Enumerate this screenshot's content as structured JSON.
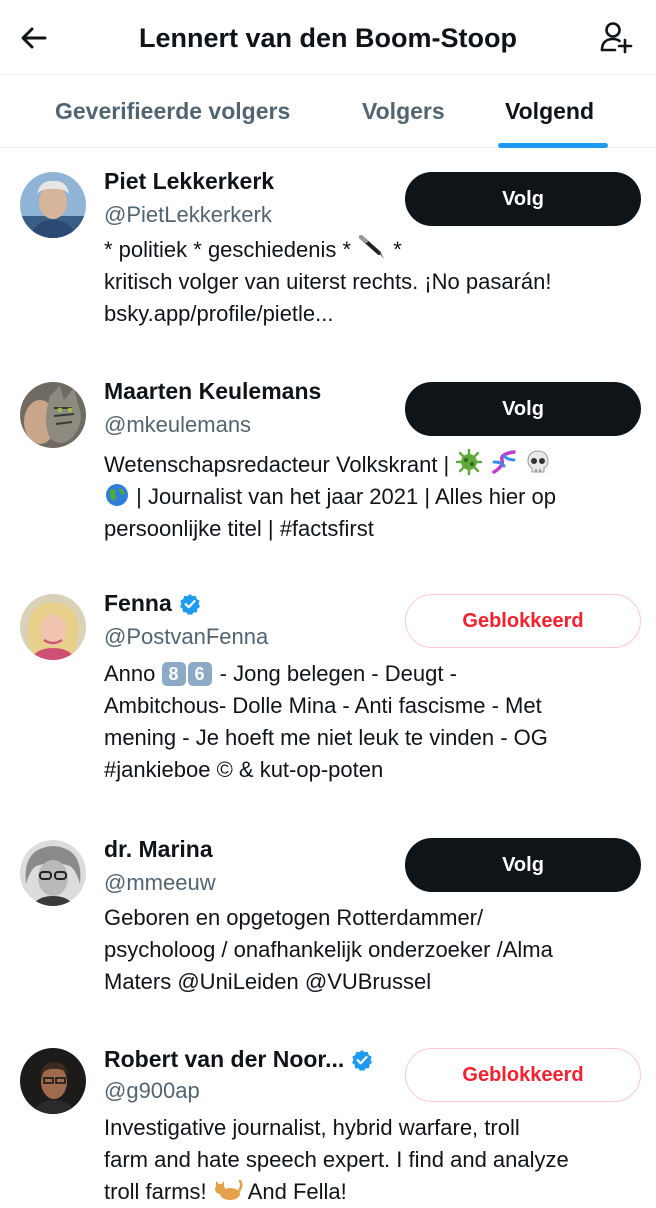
{
  "header": {
    "title": "Lennert van den Boom-Stoop",
    "back_icon": "arrow-left-icon",
    "add_icon": "person-add-icon"
  },
  "tabs": [
    {
      "label": "Geverifieerde volgers",
      "active": false
    },
    {
      "label": "Volgers",
      "active": false
    },
    {
      "label": "Volgend",
      "active": true
    }
  ],
  "colors": {
    "accent": "#1d9bf0",
    "follow_button": "#0f1419",
    "blocked_text": "#f4212e",
    "verified": "#1d9bf0"
  },
  "users": [
    {
      "name": "Piet Lekkerkerk",
      "handle": "@PietLekkerkerk",
      "verified": false,
      "button": "Volg",
      "button_type": "follow",
      "bio": {
        "line1_a": "* politiek * geschiedenis *",
        "line1_b": "*",
        "line2": "kritisch volger van uiterst rechts. ¡No pasarán!",
        "line3": "bsky.app/profile/pietle..."
      }
    },
    {
      "name": "Maarten Keulemans",
      "handle": "@mkeulemans",
      "verified": false,
      "button": "Volg",
      "button_type": "follow",
      "bio": {
        "line1": "Wetenschapsredacteur Volkskrant |",
        "line2": "| Journalist van het jaar 2021 | Alles hier op",
        "line3": "persoonlijke titel | #factsfirst"
      }
    },
    {
      "name": "Fenna",
      "handle": "@PostvanFenna",
      "verified": true,
      "button": "Geblokkeerd",
      "button_type": "blocked",
      "bio": {
        "line1_a": "Anno",
        "keycap1": "8",
        "keycap2": "6",
        "line1_b": "- Jong belegen - Deugt -",
        "line2": "Ambitchous- Dolle Mina - Anti fascisme - Met",
        "line3": "mening - Je hoeft me niet leuk te vinden - OG",
        "line4_a": "#jankieboe",
        "line4_b": "©",
        "line4_c": "& kut-op-poten"
      }
    },
    {
      "name": "dr. Marina",
      "handle": "@mmeeuw",
      "verified": false,
      "button": "Volg",
      "button_type": "follow",
      "bio": {
        "line1": "Geboren en opgetogen Rotterdammer/",
        "line2": "psycholoog / onafhankelijk onderzoeker /Alma",
        "line3": "Maters @UniLeiden @VUBrussel"
      }
    },
    {
      "name": "Robert van der Noor...",
      "handle": "@g900ap",
      "verified": true,
      "button": "Geblokkeerd",
      "button_type": "blocked",
      "bio": {
        "line1": "Investigative journalist, hybrid warfare, troll",
        "line2": "farm and hate speech expert. I find and analyze",
        "line3_a": "troll farms!",
        "line3_b": "And Fella!"
      }
    }
  ]
}
